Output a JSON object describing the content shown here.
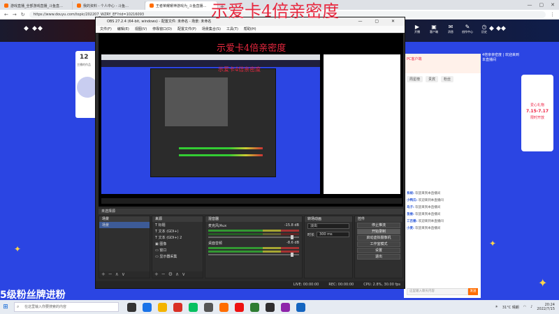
{
  "browser": {
    "tabs": [
      {
        "label": "游戏直播_全部游戏直播_斗鱼直…"
      },
      {
        "label": "我的资料 - 个人中心 - 斗鱼…"
      },
      {
        "label": "王者荣耀暖神游戏为_斗鱼直播…"
      }
    ],
    "new_tab": "+",
    "window_controls": [
      "—",
      "▢",
      "✕"
    ],
    "url": "https://www.douyu.com/topic/202207_WZRY_EF?rid=10216093"
  },
  "site": {
    "nav_icons": [
      {
        "label": "开播",
        "icon": "▶"
      },
      {
        "label": "客户端",
        "icon": "▣"
      },
      {
        "label": "消息",
        "icon": "✉"
      },
      {
        "label": "创作中心",
        "icon": "✎"
      },
      {
        "label": "历史",
        "icon": "◷"
      }
    ]
  },
  "left": {
    "count": "12",
    "count_label": "主播的作品",
    "watermark": "5级粉丝牌进粉",
    "brand": "24"
  },
  "obs": {
    "title": "OBS 27.2.4 (64-bit, windows) - 配置文件: 未命名 - 场景: 未命名",
    "window_controls": "— ▢ ✕",
    "menu": [
      "文件(F)",
      "编辑(E)",
      "视图(V)",
      "停靠窗口(D)",
      "配置文件(P)",
      "场景集合(S)",
      "工具(T)",
      "帮助(H)"
    ],
    "source_bar": "未选择源",
    "docks": {
      "scenes": {
        "header": "场景",
        "items": [
          "场景"
        ]
      },
      "sources": {
        "header": "来源",
        "items": [
          "T 标题",
          "T 文本 (GDI+)",
          "T 文本 (GDI+) 2",
          "▣ 图像",
          "▭ 窗口",
          "▭ 显示器采集"
        ]
      },
      "mixer": {
        "header": "混音器",
        "tracks": [
          {
            "name": "麦克风/Aux",
            "db": "-15.8 dB"
          },
          {
            "name": "桌面音频",
            "db": "-8.6 dB"
          }
        ]
      },
      "transitions": {
        "header": "转场动画",
        "type": "淡出",
        "duration_label": "时长",
        "duration": "300 ms"
      },
      "controls": {
        "header": "控件",
        "buttons": [
          "停止推流",
          "开始录制",
          "启动虚拟摄像机",
          "工作室模式",
          "设置",
          "退出"
        ]
      }
    },
    "status": {
      "live": "LIVE: 00:00:00",
      "rec": "REC: 00:00:00",
      "cpu": "CPU: 2.8%, 30.00 fps"
    }
  },
  "overlay": {
    "top": "示爱卡4倍亲密度",
    "mid": "示爱卡4倍亲密度",
    "small": "示爱卡4倍亲密度"
  },
  "chat": {
    "head": "PC客户端",
    "side_note": "4倍亲亲密度 | 欢迎来到本直播间",
    "tabs": [
      "周星榜",
      "贵宾",
      "粉丝"
    ],
    "lines": [
      {
        "user": "系统:",
        "text": "欢迎来到本直播间"
      },
      {
        "user": "小鸭云:",
        "text": "欢迎来到本直播间"
      },
      {
        "user": "鸟子:",
        "text": "欢迎来到本直播间"
      },
      {
        "user": "圣维:",
        "text": "欢迎来到本直播间"
      },
      {
        "user": "三百兽:",
        "text": "欢迎来到本直播间"
      },
      {
        "user": "小麦:",
        "text": "欢迎来到本直播间"
      }
    ],
    "input_placeholder": "这里输入聊天内容",
    "send": "发送"
  },
  "promo": {
    "line1": "爱心礼物",
    "dates": "7.15-7.17",
    "line2": "限时开放"
  },
  "taskbar": {
    "search_placeholder": "在这里输入你要搜索的内容",
    "temp": "31°C 晴朗",
    "time": "20:24",
    "date": "2022/7/15"
  },
  "colors": {
    "accent": "#ff6d00",
    "overlay_red": "#e8283f",
    "page_blue": "#2b45e3"
  }
}
